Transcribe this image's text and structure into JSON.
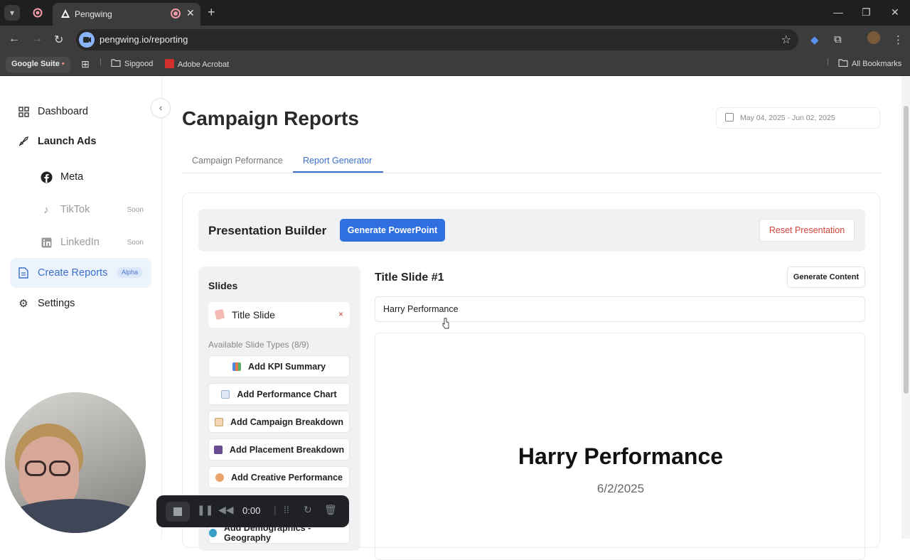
{
  "browser": {
    "tab_title": "Pengwing",
    "url": "pengwing.io/reporting",
    "bookmarks": {
      "group": "Google Suite",
      "items": [
        "Sipgood",
        "Adobe Acrobat"
      ],
      "all": "All Bookmarks"
    }
  },
  "sidebar": {
    "items": [
      {
        "label": "Dashboard"
      },
      {
        "label": "Launch Ads"
      },
      {
        "label": "Meta"
      },
      {
        "label": "TikTok",
        "badge": "Soon"
      },
      {
        "label": "LinkedIn",
        "badge": "Soon"
      },
      {
        "label": "Create Reports",
        "badge": "Alpha"
      },
      {
        "label": "Settings"
      }
    ]
  },
  "page": {
    "title": "Campaign Reports",
    "date_range": "May 04, 2025 - Jun 02, 2025",
    "tabs": [
      "Campaign Peformance",
      "Report Generator"
    ],
    "active_tab": "Report Generator"
  },
  "builder": {
    "title": "Presentation Builder",
    "generate_label": "Generate PowerPoint",
    "reset_label": "Reset Presentation"
  },
  "slides": {
    "header": "Slides",
    "current": "Title Slide",
    "remove_glyph": "×",
    "available_label": "Available Slide Types (8/9)",
    "add_buttons": [
      "Add KPI Summary",
      "Add Performance Chart",
      "Add Campaign Breakdown",
      "Add Placement Breakdown",
      "Add Creative Performance",
      "Add Demographics - Geography"
    ]
  },
  "editor": {
    "slide_title": "Title Slide #1",
    "generate_content_label": "Generate Content",
    "input_value": "Harry Performance",
    "preview_title": "Harry Performance",
    "preview_date": "6/2/2025"
  },
  "recorder": {
    "time": "0:00"
  },
  "colors": {
    "accent": "#2f6fe0",
    "active_nav_bg": "#edf3fc",
    "danger": "#d1453b"
  }
}
